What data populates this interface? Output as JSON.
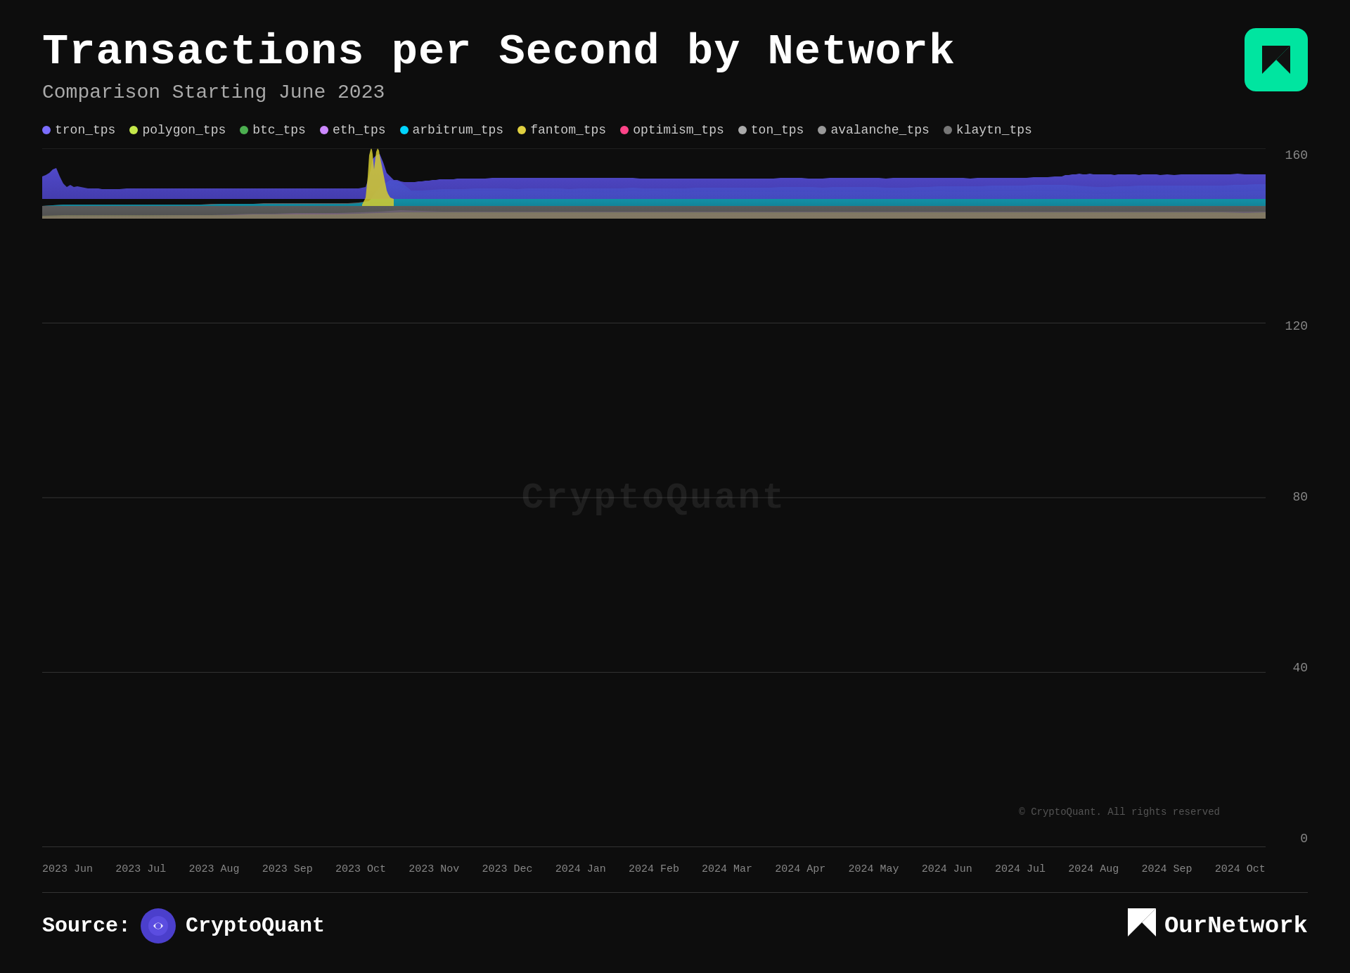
{
  "header": {
    "main_title": "Transactions per Second by Network",
    "subtitle": "Comparison Starting June 2023",
    "logo_alt": "OurNetwork icon"
  },
  "legend": {
    "items": [
      {
        "id": "tron_tps",
        "label": "tron_tps",
        "color": "#7b6dff"
      },
      {
        "id": "polygon_tps",
        "label": "polygon_tps",
        "color": "#c5e84a"
      },
      {
        "id": "btc_tps",
        "label": "btc_tps",
        "color": "#4caf50"
      },
      {
        "id": "eth_tps",
        "label": "eth_tps",
        "color": "#cc88ff"
      },
      {
        "id": "arbitrum_tps",
        "label": "arbitrum_tps",
        "color": "#00d4ff"
      },
      {
        "id": "fantom_tps",
        "label": "fantom_tps",
        "color": "#e0d040"
      },
      {
        "id": "optimism_tps",
        "label": "optimism_tps",
        "color": "#ff4488"
      },
      {
        "id": "ton_tps",
        "label": "ton_tps",
        "color": "#aaaaaa"
      },
      {
        "id": "avalanche_tps",
        "label": "avalanche_tps",
        "color": "#999999"
      },
      {
        "id": "klaytn_tps",
        "label": "klaytn_tps",
        "color": "#777777"
      }
    ]
  },
  "y_axis": {
    "labels": [
      "160",
      "120",
      "80",
      "40",
      "0"
    ]
  },
  "x_axis": {
    "labels": [
      "2023 Jun",
      "2023 Jul",
      "2023 Aug",
      "2023 Sep",
      "2023 Oct",
      "2023 Nov",
      "2023 Dec",
      "2024 Jan",
      "2024 Feb",
      "2024 Mar",
      "2024 Apr",
      "2024 May",
      "2024 Jun",
      "2024 Jul",
      "2024 Aug",
      "2024 Sep",
      "2024 Oct"
    ]
  },
  "watermark": "CryptoQuant",
  "copyright": "© CryptoQuant. All rights reserved",
  "footer": {
    "source_label": "Source:",
    "cryptoquant_label": "CryptoQuant",
    "ournetwork_label": "OurNetwork"
  }
}
